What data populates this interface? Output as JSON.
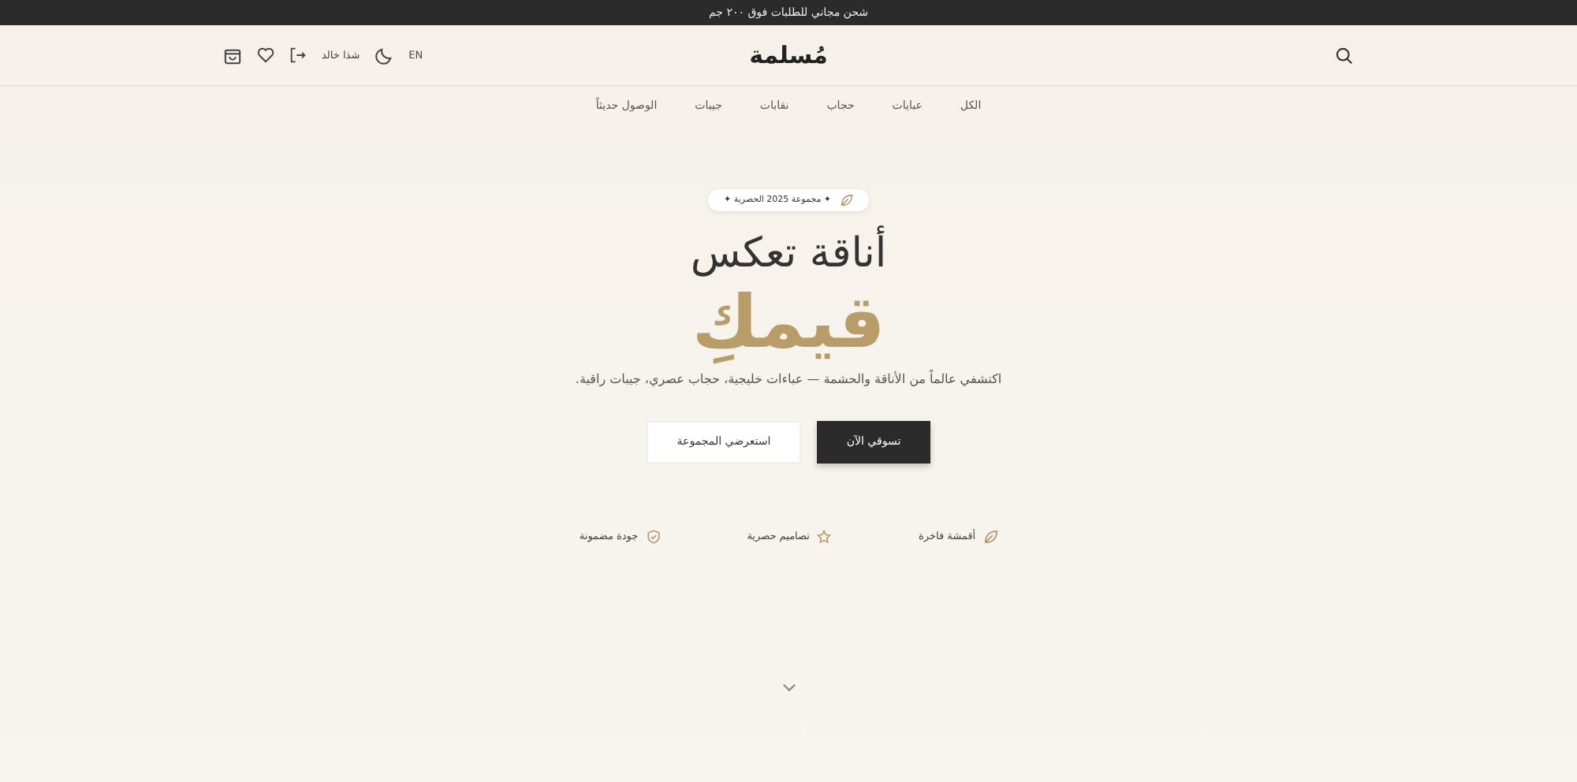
{
  "announcement": "شحن مجاني للطلبات فوق ٢٠٠ جم",
  "header": {
    "logo": "مُسلمة",
    "language": "EN",
    "user_name": "شذا خالد"
  },
  "nav": [
    {
      "label": "الكل"
    },
    {
      "label": "عبايات"
    },
    {
      "label": "حجاب"
    },
    {
      "label": "نقابات"
    },
    {
      "label": "جيبات"
    },
    {
      "label": "الوصول حديثاً"
    }
  ],
  "hero": {
    "badge": "✦ مجموعة 2025 الحصرية ✦",
    "headline": "أناقة تعكس",
    "highlight": "قيمكِ",
    "subtitle": "اكتشفي عالماً من الأناقة والحشمة — عباءات خليجية، حجاب عصري، جيبات راقية.",
    "buttons": [
      {
        "label": "تسوقي الآن",
        "kind": "primary"
      },
      {
        "label": "استعرضي المجموعة",
        "kind": "secondary"
      }
    ],
    "features": [
      {
        "label": "أقمشة فاخرة",
        "kind": "leaf"
      },
      {
        "label": "تصاميم حصرية",
        "kind": "star"
      },
      {
        "label": "جودة مضمونة",
        "kind": "shield"
      }
    ]
  }
}
